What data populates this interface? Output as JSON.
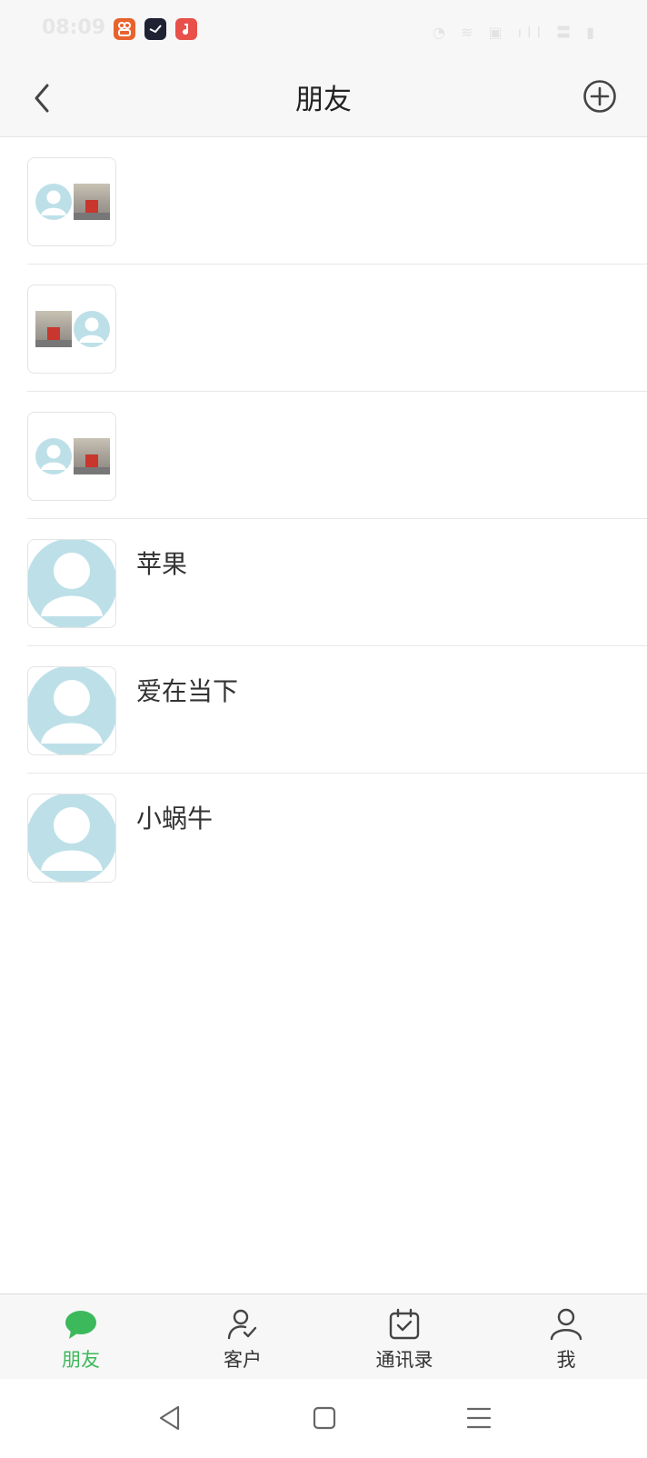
{
  "status_bar": {
    "time": "08:09",
    "right": "◔ ≋ ▣ ıll 〓 ▮"
  },
  "nav": {
    "title": "朋友",
    "back_icon": "chevron-left-icon",
    "add_icon": "plus-circle-icon"
  },
  "friends": [
    {
      "name": "",
      "avatar": "group-person-photo"
    },
    {
      "name": "",
      "avatar": "group-photo-person"
    },
    {
      "name": "",
      "avatar": "group-person-photo"
    },
    {
      "name": "苹果",
      "avatar": "person"
    },
    {
      "name": "爱在当下",
      "avatar": "person"
    },
    {
      "name": "小蜗牛",
      "avatar": "person"
    }
  ],
  "tabs": [
    {
      "label": "朋友",
      "icon": "chat-bubble-icon",
      "active": true
    },
    {
      "label": "客户",
      "icon": "user-check-icon",
      "active": false
    },
    {
      "label": "通讯录",
      "icon": "calendar-check-icon",
      "active": false
    },
    {
      "label": "我",
      "icon": "user-icon",
      "active": false
    }
  ],
  "colors": {
    "accent": "#3cb95a",
    "avatar": "#bde0e8",
    "bar_bg": "#f7f7f7"
  }
}
